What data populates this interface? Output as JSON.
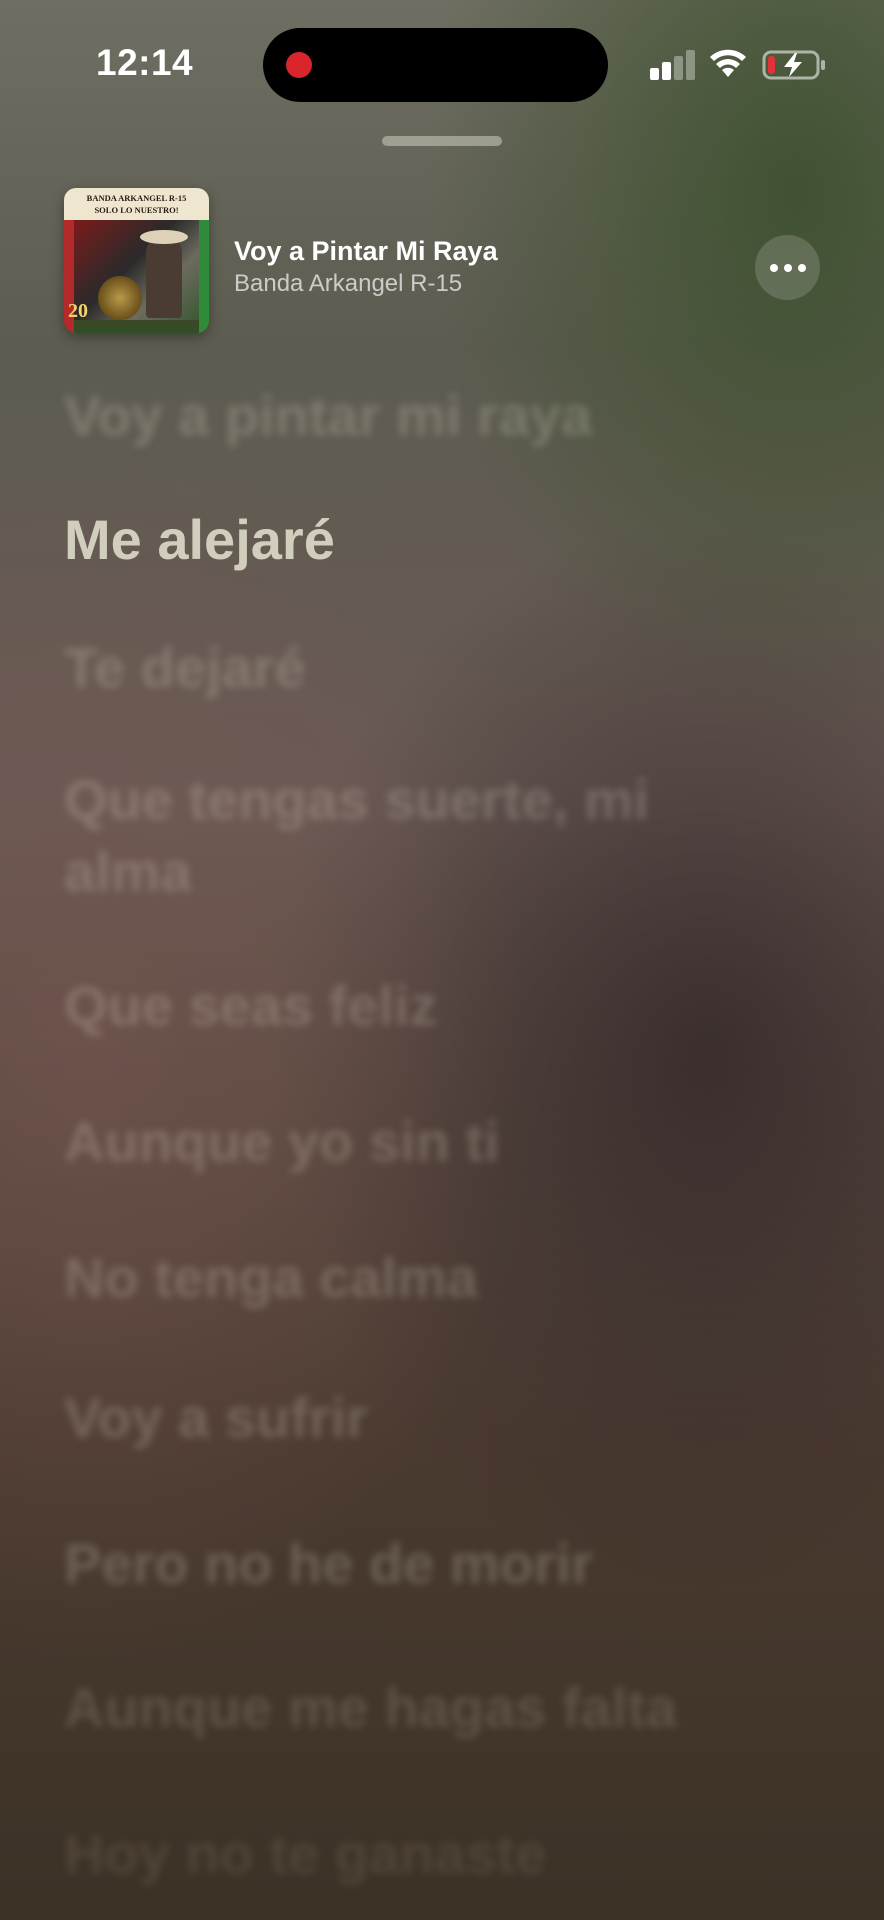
{
  "status_bar": {
    "time": "12:14"
  },
  "now_playing": {
    "title": "Voy a Pintar Mi Raya",
    "artist": "Banda Arkangel R-15",
    "artwork": {
      "banner_line1": "BANDA ARKANGEL R-15",
      "banner_line2": "SOLO LO NUESTRO!",
      "badge": "20"
    }
  },
  "lyrics": {
    "current_index": 1,
    "lines": [
      "Voy a pintar mi raya",
      "Me alejaré",
      "Te dejaré",
      "Que tengas suerte, mi alma",
      "Que seas feliz",
      "Aunque yo sin ti",
      "No tenga calma",
      "Voy a sufrir",
      "Pero no he de morir",
      "Aunque me hagas falta",
      "Hoy no te ganaste"
    ]
  },
  "colors": {
    "accent_record": "#d9262c",
    "battery_low": "#e0333a"
  }
}
